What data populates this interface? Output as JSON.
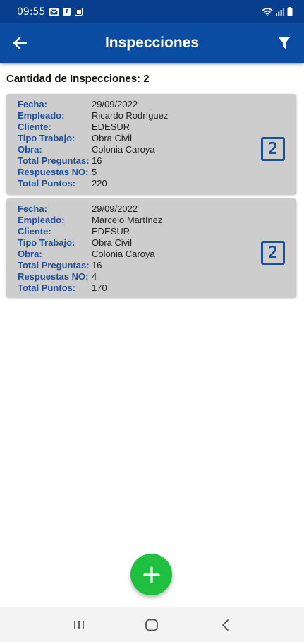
{
  "status_bar": {
    "time": "09:55",
    "icons": [
      "mail-icon",
      "facebook-icon",
      "app-notification-icon",
      "wifi-icon",
      "signal-icon",
      "battery-icon"
    ]
  },
  "app_bar": {
    "title": "Inspecciones",
    "back_icon": "arrow-left-icon",
    "filter_icon": "filter-icon"
  },
  "summary": {
    "count_text": "Cantidad de Inspecciones: 2"
  },
  "labels": {
    "fecha": "Fecha:",
    "empleado": "Empleado:",
    "cliente": "Cliente:",
    "tipo_trabajo": "Tipo Trabajo:",
    "obra": "Obra:",
    "total_preguntas": "Total Preguntas:",
    "respuestas_no": "Respuestas NO:",
    "total_puntos": "Total Puntos:"
  },
  "inspections": [
    {
      "fecha": "29/09/2022",
      "empleado": "Ricardo Rodríguez",
      "cliente": "EDESUR",
      "tipo_trabajo": "Obra Civil",
      "obra": "Colonia Caroya",
      "total_preguntas": "16",
      "respuestas_no": "5",
      "total_puntos": "220",
      "badge": "2"
    },
    {
      "fecha": "29/09/2022",
      "empleado": "Marcelo Martínez",
      "cliente": "EDESUR",
      "tipo_trabajo": "Obra Civil",
      "obra": "Colonia Caroya",
      "total_preguntas": "16",
      "respuestas_no": "4",
      "total_puntos": "170",
      "badge": "2"
    }
  ],
  "fab": {
    "icon": "plus-icon"
  },
  "nav_bar": {
    "icons": [
      "recent-apps-icon",
      "home-icon",
      "back-icon"
    ]
  },
  "colors": {
    "primary": "#0b4da2",
    "status_bar": "#073f8e",
    "label": "#1b4f9b",
    "card": "#cdcdcd",
    "fab": "#1fbf3f"
  }
}
